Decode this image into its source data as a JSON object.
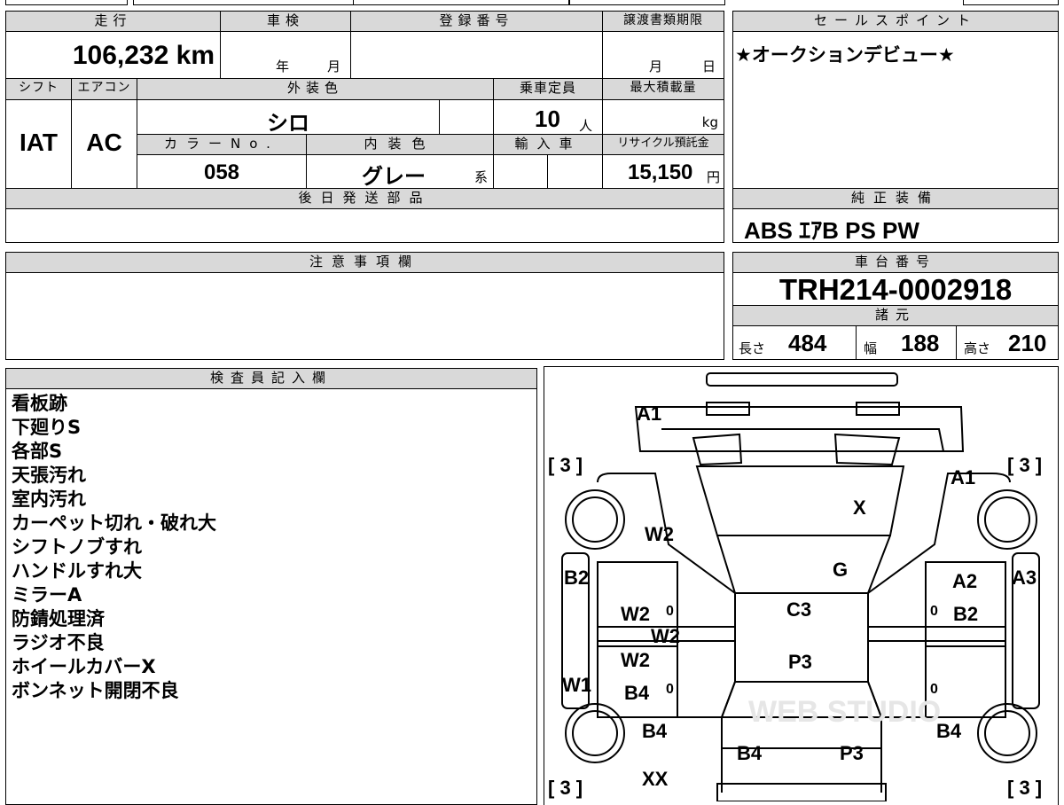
{
  "header": {
    "mileage_label": "走行",
    "mileage_value": "106,232 km",
    "inspection_label": "車検",
    "inspection_year": "年",
    "inspection_month": "月",
    "registration_label": "登録番号",
    "registration_value": "",
    "transfer_label": "譲渡書類期限",
    "transfer_month": "月",
    "transfer_day": "日"
  },
  "specs": {
    "shift_label": "シフト",
    "shift_value": "IAT",
    "ac_label": "エアコン",
    "ac_value": "AC",
    "exterior_label": "外装色",
    "exterior_value": "シロ",
    "capacity_label": "乗車定員",
    "capacity_value": "10",
    "capacity_unit": "人",
    "load_label": "最大積載量",
    "load_unit": "kg",
    "color_no_label": "カラーNo.",
    "color_no_value": "058",
    "interior_label": "内装色",
    "interior_value": "グレー",
    "interior_suffix": "系",
    "import_label": "輸入車",
    "recycle_label": "リサイクル預託金",
    "recycle_value": "15,150",
    "recycle_unit": "円"
  },
  "later_parts": {
    "label": "後日発送部品",
    "value": ""
  },
  "sales_point": {
    "label": "セールスポイント",
    "value": "★オークションデビュー★"
  },
  "equipment": {
    "label": "純正装備",
    "value": "ABS ｴｱB PS PW"
  },
  "caution": {
    "label": "注意事項欄",
    "value": ""
  },
  "chassis": {
    "label": "車台番号",
    "value": "TRH214-0002918"
  },
  "dimensions": {
    "label": "諸元",
    "length_label": "長さ",
    "length_value": "484",
    "width_label": "幅",
    "width_value": "188",
    "height_label": "高さ",
    "height_value": "210"
  },
  "inspector": {
    "label": "検査員記入欄",
    "notes": [
      "看板跡",
      "下廻りS",
      "各部S",
      "天張汚れ",
      "室内汚れ",
      "カーペット切れ・破れ大",
      "シフトノブすれ",
      "ハンドルすれ大",
      "ミラーA",
      "防錆処理済",
      "ラジオ不良",
      "ホイールカバーX",
      "ボンネット開閉不良"
    ]
  },
  "diagram": {
    "tire_marks": [
      "[ 3 ]",
      "[ 3 ]",
      "[ 3 ]",
      "[ 3 ]"
    ],
    "damage_codes": {
      "a1_front_left": "A1",
      "x_windshield": "X",
      "a1_right": "A1",
      "w2_left_front": "W2",
      "g_roof_front": "G",
      "b2_left": "B2",
      "a2_right": "A2",
      "a3_right": "A3",
      "w2_left_door": "W2",
      "c3_roof": "C3",
      "b2_right": "B2",
      "w2_left_mid": "W2",
      "w2_left_lower": "W2",
      "p3_roof": "P3",
      "w1_left": "W1",
      "b4_left_door": "B4",
      "b4_left_rear": "B4",
      "b4_right_rear": "B4",
      "b4_rear": "B4",
      "p3_rear": "P3",
      "xx_rear": "XX"
    },
    "watermark": "WEB STUDIO"
  }
}
